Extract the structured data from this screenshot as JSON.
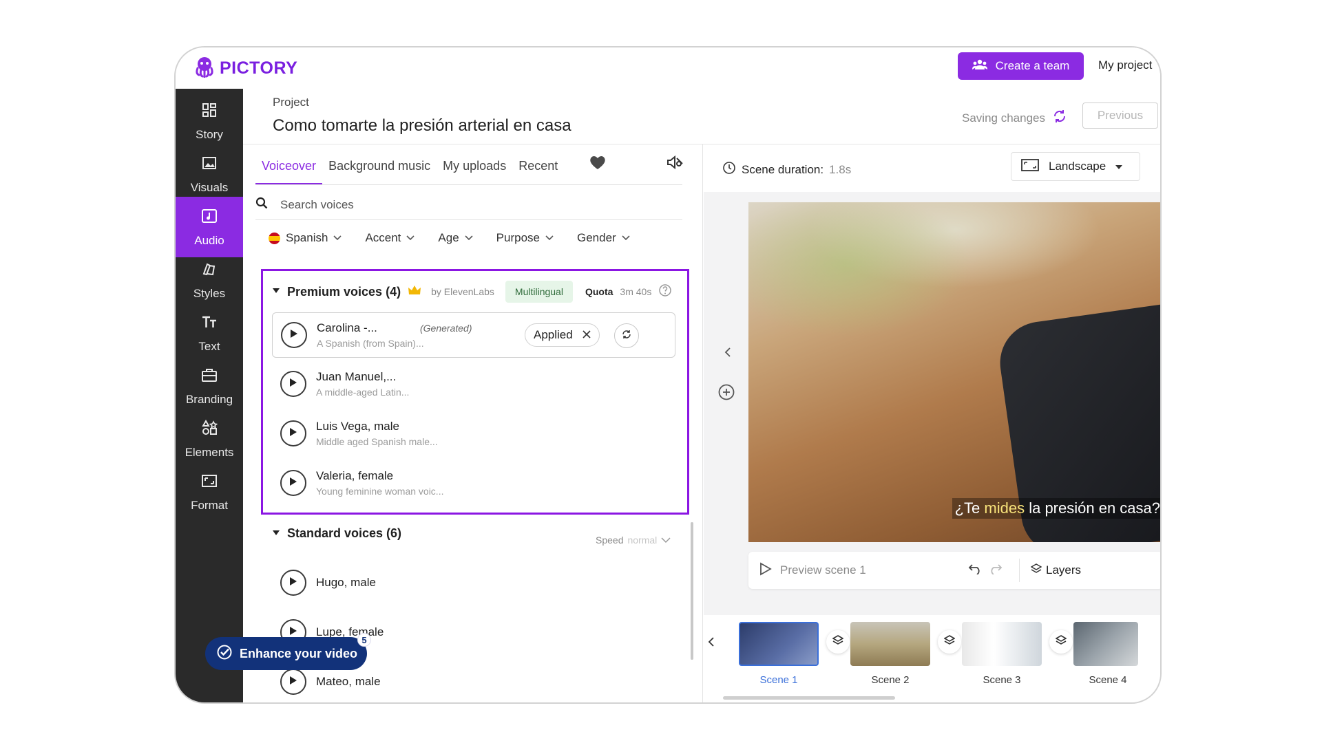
{
  "app": {
    "name": "PICTORY"
  },
  "header": {
    "create_team": "Create a team",
    "my_project": "My project"
  },
  "sidebar": {
    "items": [
      {
        "label": "Story",
        "icon": "grid-icon"
      },
      {
        "label": "Visuals",
        "icon": "image-icon"
      },
      {
        "label": "Audio",
        "icon": "music-icon",
        "active": true
      },
      {
        "label": "Styles",
        "icon": "palette-icon"
      },
      {
        "label": "Text",
        "icon": "text-icon"
      },
      {
        "label": "Branding",
        "icon": "briefcase-icon"
      },
      {
        "label": "Elements",
        "icon": "shapes-icon"
      },
      {
        "label": "Format",
        "icon": "format-icon"
      }
    ]
  },
  "project": {
    "label": "Project",
    "title": "Como tomarte la presión arterial en casa",
    "saving": "Saving changes",
    "previous": "Previous"
  },
  "audio": {
    "tabs": [
      "Voiceover",
      "Background music",
      "My uploads",
      "Recent"
    ],
    "search_placeholder": "Search voices",
    "filters": [
      "Spanish",
      "Accent",
      "Age",
      "Purpose",
      "Gender"
    ],
    "premium": {
      "title": "Premium voices (4)",
      "by": "by ElevenLabs",
      "badge": "Multilingual",
      "quota_label": "Quota",
      "quota_value": "3m 40s",
      "voices": [
        {
          "name": "Carolina -...",
          "desc": "A Spanish (from Spain)...",
          "tag": "(Generated)",
          "applied_label": "Applied"
        },
        {
          "name": "Juan Manuel,...",
          "desc": "A middle-aged Latin..."
        },
        {
          "name": "Luis Vega, male",
          "desc": "Middle aged Spanish male..."
        },
        {
          "name": "Valeria, female",
          "desc": "Young feminine woman voic..."
        }
      ]
    },
    "standard": {
      "title": "Standard voices (6)",
      "speed_label": "Speed",
      "speed_value": "normal",
      "voices": [
        {
          "name": "Hugo, male"
        },
        {
          "name": "Lupe, female"
        },
        {
          "name": "Mateo, male"
        }
      ]
    },
    "enhance": {
      "label": "Enhance your video",
      "count": "5"
    }
  },
  "preview": {
    "scene_duration_label": "Scene duration:",
    "scene_duration_value": "1.8s",
    "orientation": "Landscape",
    "caption_pre": "¿Te ",
    "caption_hl": "mides",
    "caption_post": " la presión en casa?",
    "preview_label": "Preview scene 1",
    "layers_label": "Layers"
  },
  "timeline": {
    "scenes": [
      "Scene 1",
      "Scene 2",
      "Scene 3",
      "Scene 4"
    ]
  },
  "colors": {
    "accent": "#8b2be2",
    "sidebar": "#2a2a2a",
    "highlight_box": "#8b16e3",
    "enhance": "#12327a"
  }
}
